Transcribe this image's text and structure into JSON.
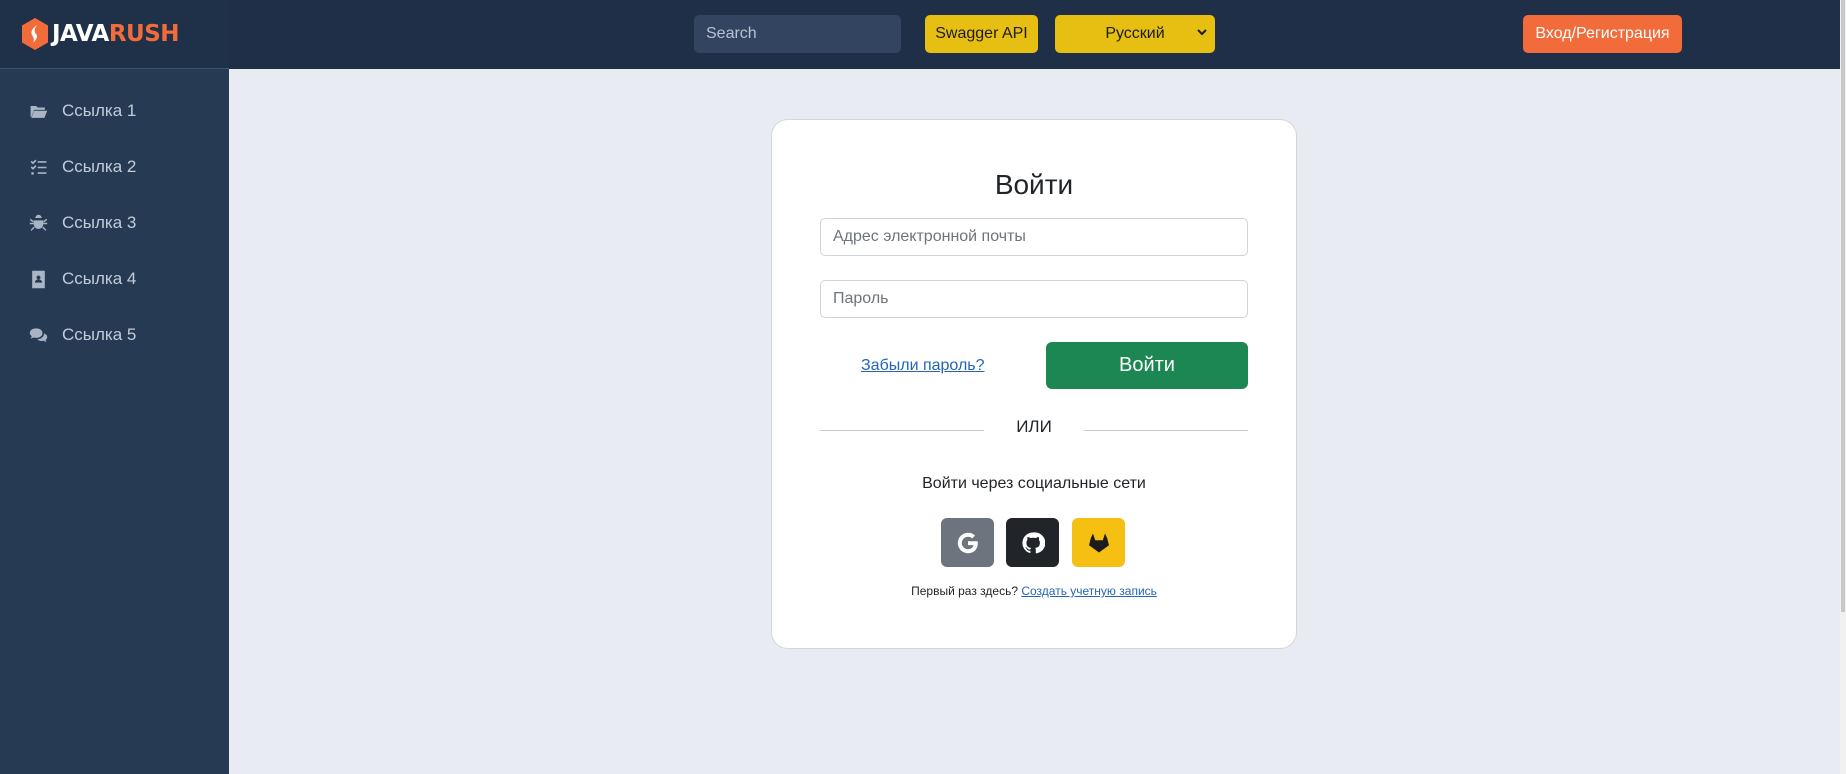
{
  "logo": {
    "part1": "JAVA",
    "part2": "RUSH"
  },
  "sidebar": {
    "items": [
      {
        "label": "Ссылка 1",
        "icon": "folder-open-icon"
      },
      {
        "label": "Ссылка 2",
        "icon": "list-check-icon"
      },
      {
        "label": "Ссылка 3",
        "icon": "bug-icon"
      },
      {
        "label": "Ссылка 4",
        "icon": "contact-book-icon"
      },
      {
        "label": "Ссылка 5",
        "icon": "comments-icon"
      }
    ]
  },
  "header": {
    "search_placeholder": "Search",
    "swagger_label": "Swagger API",
    "language_selected": "Русский",
    "login_label": "Вход/Регистрация"
  },
  "login": {
    "title": "Войти",
    "email_placeholder": "Адрес электронной почты",
    "password_placeholder": "Пароль",
    "forgot_label": "Забыли пароль?",
    "submit_label": "Войти",
    "divider_text": "ИЛИ",
    "social_label": "Войти через социальные сети",
    "social": [
      {
        "name": "google",
        "icon": "google-icon"
      },
      {
        "name": "github",
        "icon": "github-icon"
      },
      {
        "name": "gitlab",
        "icon": "gitlab-icon"
      }
    ],
    "first_time_text": "Первый раз здесь?",
    "create_account_label": "Создать учетную запись"
  },
  "colors": {
    "sidebar_bg": "#273a53",
    "header_bg": "#1f2f48",
    "page_bg": "#e8ebf2",
    "accent_orange": "#f26b3a",
    "accent_yellow": "#e6bf12",
    "submit_green": "#1c8753"
  }
}
